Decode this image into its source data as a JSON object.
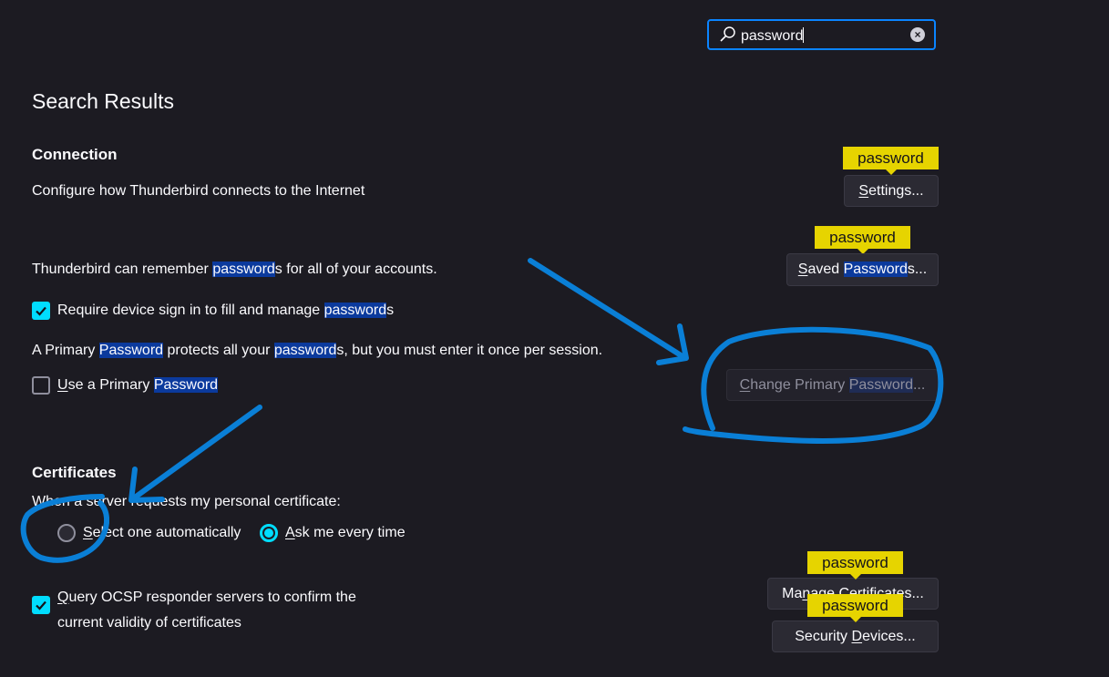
{
  "search": {
    "value": "password",
    "clear_icon": "×"
  },
  "page": {
    "title": "Search Results"
  },
  "connection": {
    "heading": "Connection",
    "description": "Configure how Thunderbird connects to the Internet",
    "settings_button": {
      "access_key": "S",
      "rest": "ettings..."
    }
  },
  "passwords": {
    "remember_pre": "Thunderbird can remember ",
    "remember_hl": "password",
    "remember_post": "s for all of your accounts.",
    "saved_button": {
      "access_key": "S",
      "part1": "aved ",
      "hl": "Password",
      "part2": "s..."
    },
    "require_label_pre": "Require device sign in to fill and manage ",
    "require_label_hl": "password",
    "require_label_post": "s",
    "require_checked": true,
    "primary_desc_pre": "A Primary ",
    "primary_desc_hl1": "Password",
    "primary_desc_mid": " protects all your ",
    "primary_desc_hl2": "password",
    "primary_desc_post": "s, but you must enter it once per session.",
    "use_primary_access": "U",
    "use_primary_pre": "se a Primary ",
    "use_primary_hl": "Password",
    "use_primary_checked": false,
    "change_button": {
      "access_key": "C",
      "part1": "hange Primary ",
      "hl": "Password",
      "part2": "..."
    }
  },
  "certificates": {
    "heading": "Certificates",
    "request_label": "When a server requests my personal certificate:",
    "radio_auto": {
      "access_key": "S",
      "rest": "elect one automatically",
      "selected": false
    },
    "radio_ask": {
      "access_key": "A",
      "rest": "sk me every time",
      "selected": true
    },
    "ocsp_access": "Q",
    "ocsp_line1_rest": "uery OCSP responder servers to confirm the",
    "ocsp_line2": "current validity of certificates",
    "ocsp_checked": true,
    "manage_button": {
      "part1": "Ma",
      "access_key": "n",
      "part2": "age Certificates..."
    },
    "devices_button": {
      "part1": "Security ",
      "access_key": "D",
      "part2": "evices..."
    }
  },
  "tooltips": {
    "word": "password"
  },
  "colors": {
    "accent": "#0a84ff",
    "highlight": "#0b3a9d",
    "tooltip": "#e6d400",
    "annotation": "#0a7fd6"
  }
}
